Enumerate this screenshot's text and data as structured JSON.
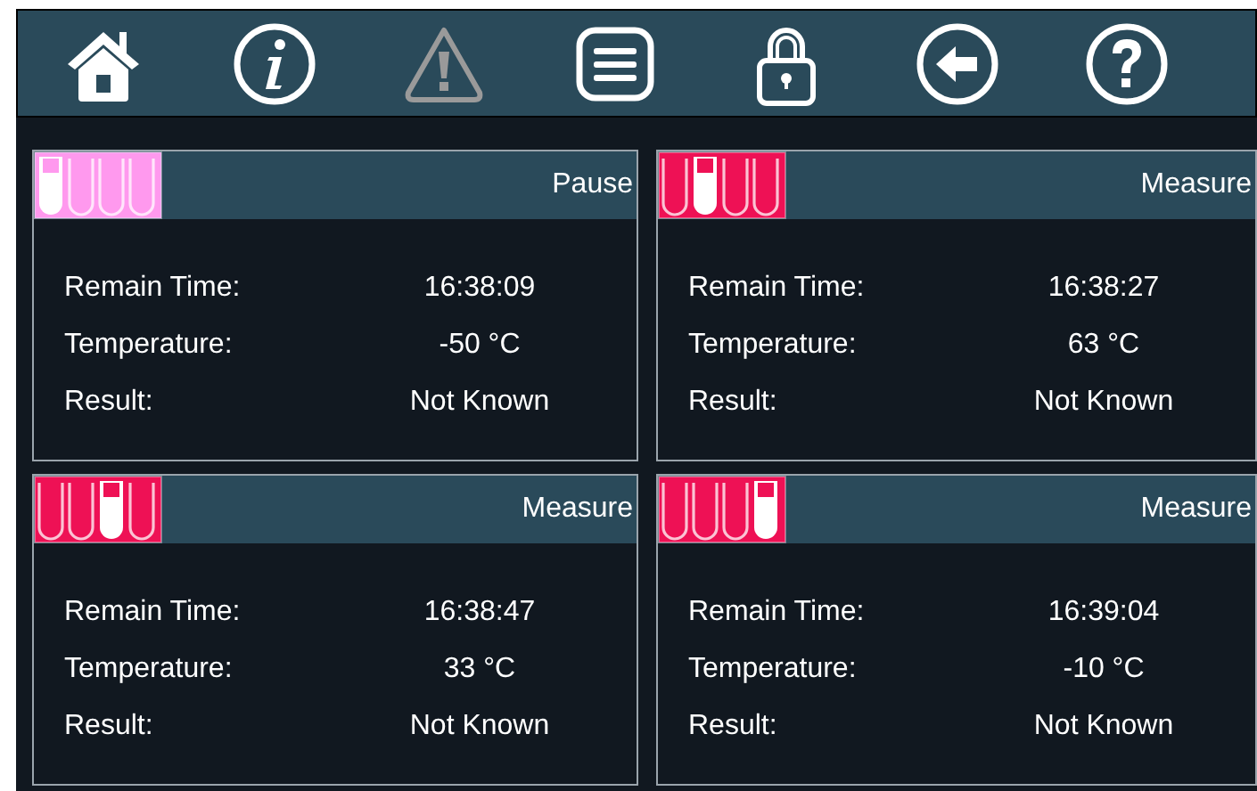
{
  "toolbar": [
    {
      "kind": "home",
      "disabled": false
    },
    {
      "kind": "info",
      "disabled": false
    },
    {
      "kind": "warning",
      "disabled": true
    },
    {
      "kind": "menu",
      "disabled": false
    },
    {
      "kind": "lock",
      "disabled": false
    },
    {
      "kind": "back",
      "disabled": false
    },
    {
      "kind": "help",
      "disabled": false
    }
  ],
  "panels": [
    {
      "status": "Pause",
      "color": "#ff99ee",
      "tubes": [
        {
          "filled": true
        },
        {
          "filled": false
        },
        {
          "filled": false
        },
        {
          "filled": false
        }
      ],
      "rows": [
        {
          "label": "Remain Time:",
          "value": "16:38:09"
        },
        {
          "label": "Temperature:",
          "value": "-50 °C"
        },
        {
          "label": "Result:",
          "value": "Not Known"
        }
      ]
    },
    {
      "status": "Measure",
      "color": "#ee1155",
      "tubes": [
        {
          "filled": false
        },
        {
          "filled": true
        },
        {
          "filled": false
        },
        {
          "filled": false
        }
      ],
      "rows": [
        {
          "label": "Remain Time:",
          "value": "16:38:27"
        },
        {
          "label": "Temperature:",
          "value": "63 °C"
        },
        {
          "label": "Result:",
          "value": "Not Known"
        }
      ]
    },
    {
      "status": "Measure",
      "color": "#ee1155",
      "tubes": [
        {
          "filled": false
        },
        {
          "filled": false
        },
        {
          "filled": true
        },
        {
          "filled": false
        }
      ],
      "rows": [
        {
          "label": "Remain Time:",
          "value": "16:38:47"
        },
        {
          "label": "Temperature:",
          "value": "33 °C"
        },
        {
          "label": "Result:",
          "value": "Not Known"
        }
      ]
    },
    {
      "status": "Measure",
      "color": "#ee1155",
      "tubes": [
        {
          "filled": false
        },
        {
          "filled": false
        },
        {
          "filled": false
        },
        {
          "filled": true
        }
      ],
      "rows": [
        {
          "label": "Remain Time:",
          "value": "16:39:04"
        },
        {
          "label": "Temperature:",
          "value": "-10 °C"
        },
        {
          "label": "Result:",
          "value": "Not Known"
        }
      ]
    }
  ]
}
